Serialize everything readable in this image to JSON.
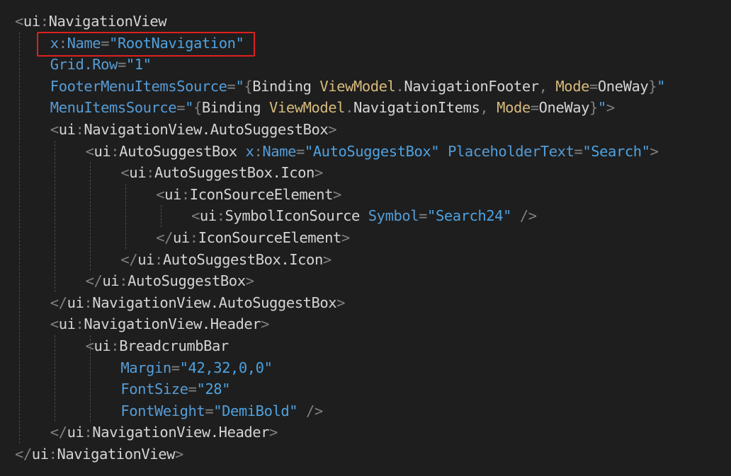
{
  "colors": {
    "background": "#1e1e1e",
    "bracket": "#808080",
    "element": "#d4d4d4",
    "prefix": "#9cdcfe",
    "attribute": "#569cd6",
    "value": "#4ea2e0",
    "markup": "#d7ba7d",
    "highlight": "#e02020"
  },
  "lines": [
    {
      "indent": 0,
      "tokens": [
        {
          "t": "<",
          "c": "bracket"
        },
        {
          "t": "ui",
          "c": "element"
        },
        {
          "t": ":",
          "c": "bracket"
        },
        {
          "t": "NavigationView",
          "c": "element"
        }
      ]
    },
    {
      "indent": 1,
      "highlight": true,
      "tokens": [
        {
          "t": "x",
          "c": "attribute"
        },
        {
          "t": ":",
          "c": "bracket"
        },
        {
          "t": "Name",
          "c": "attribute"
        },
        {
          "t": "=",
          "c": "bracket"
        },
        {
          "t": "\"RootNavigation\"",
          "c": "value"
        }
      ]
    },
    {
      "indent": 1,
      "tokens": [
        {
          "t": "Grid.Row",
          "c": "attribute"
        },
        {
          "t": "=",
          "c": "bracket"
        },
        {
          "t": "\"1\"",
          "c": "value"
        }
      ]
    },
    {
      "indent": 1,
      "tokens": [
        {
          "t": "FooterMenuItemsSource",
          "c": "attribute"
        },
        {
          "t": "=",
          "c": "bracket"
        },
        {
          "t": "\"",
          "c": "value"
        },
        {
          "t": "{",
          "c": "bracket"
        },
        {
          "t": "Binding ",
          "c": "element"
        },
        {
          "t": "ViewModel",
          "c": "markup"
        },
        {
          "t": ".",
          "c": "bracket"
        },
        {
          "t": "NavigationFooter",
          "c": "element"
        },
        {
          "t": ", ",
          "c": "bracket"
        },
        {
          "t": "Mode",
          "c": "markup"
        },
        {
          "t": "=",
          "c": "bracket"
        },
        {
          "t": "OneWay",
          "c": "element"
        },
        {
          "t": "}",
          "c": "bracket"
        },
        {
          "t": "\"",
          "c": "value"
        }
      ]
    },
    {
      "indent": 1,
      "tokens": [
        {
          "t": "MenuItemsSource",
          "c": "attribute"
        },
        {
          "t": "=",
          "c": "bracket"
        },
        {
          "t": "\"",
          "c": "value"
        },
        {
          "t": "{",
          "c": "bracket"
        },
        {
          "t": "Binding ",
          "c": "element"
        },
        {
          "t": "ViewModel",
          "c": "markup"
        },
        {
          "t": ".",
          "c": "bracket"
        },
        {
          "t": "NavigationItems",
          "c": "element"
        },
        {
          "t": ", ",
          "c": "bracket"
        },
        {
          "t": "Mode",
          "c": "markup"
        },
        {
          "t": "=",
          "c": "bracket"
        },
        {
          "t": "OneWay",
          "c": "element"
        },
        {
          "t": "}",
          "c": "bracket"
        },
        {
          "t": "\"",
          "c": "value"
        },
        {
          "t": ">",
          "c": "bracket"
        }
      ]
    },
    {
      "indent": 1,
      "tokens": [
        {
          "t": "<",
          "c": "bracket"
        },
        {
          "t": "ui",
          "c": "element"
        },
        {
          "t": ":",
          "c": "bracket"
        },
        {
          "t": "NavigationView.AutoSuggestBox",
          "c": "element"
        },
        {
          "t": ">",
          "c": "bracket"
        }
      ]
    },
    {
      "indent": 2,
      "tokens": [
        {
          "t": "<",
          "c": "bracket"
        },
        {
          "t": "ui",
          "c": "element"
        },
        {
          "t": ":",
          "c": "bracket"
        },
        {
          "t": "AutoSuggestBox ",
          "c": "element"
        },
        {
          "t": "x",
          "c": "attribute"
        },
        {
          "t": ":",
          "c": "bracket"
        },
        {
          "t": "Name",
          "c": "attribute"
        },
        {
          "t": "=",
          "c": "bracket"
        },
        {
          "t": "\"AutoSuggestBox\"",
          "c": "value"
        },
        {
          "t": " ",
          "c": "element"
        },
        {
          "t": "PlaceholderText",
          "c": "attribute"
        },
        {
          "t": "=",
          "c": "bracket"
        },
        {
          "t": "\"Search\"",
          "c": "value"
        },
        {
          "t": ">",
          "c": "bracket"
        }
      ]
    },
    {
      "indent": 3,
      "tokens": [
        {
          "t": "<",
          "c": "bracket"
        },
        {
          "t": "ui",
          "c": "element"
        },
        {
          "t": ":",
          "c": "bracket"
        },
        {
          "t": "AutoSuggestBox.Icon",
          "c": "element"
        },
        {
          "t": ">",
          "c": "bracket"
        }
      ]
    },
    {
      "indent": 4,
      "tokens": [
        {
          "t": "<",
          "c": "bracket"
        },
        {
          "t": "ui",
          "c": "element"
        },
        {
          "t": ":",
          "c": "bracket"
        },
        {
          "t": "IconSourceElement",
          "c": "element"
        },
        {
          "t": ">",
          "c": "bracket"
        }
      ]
    },
    {
      "indent": 5,
      "tokens": [
        {
          "t": "<",
          "c": "bracket"
        },
        {
          "t": "ui",
          "c": "element"
        },
        {
          "t": ":",
          "c": "bracket"
        },
        {
          "t": "SymbolIconSource ",
          "c": "element"
        },
        {
          "t": "Symbol",
          "c": "attribute"
        },
        {
          "t": "=",
          "c": "bracket"
        },
        {
          "t": "\"Search24\"",
          "c": "value"
        },
        {
          "t": " />",
          "c": "bracket"
        }
      ]
    },
    {
      "indent": 4,
      "tokens": [
        {
          "t": "</",
          "c": "bracket"
        },
        {
          "t": "ui",
          "c": "element"
        },
        {
          "t": ":",
          "c": "bracket"
        },
        {
          "t": "IconSourceElement",
          "c": "element"
        },
        {
          "t": ">",
          "c": "bracket"
        }
      ]
    },
    {
      "indent": 3,
      "tokens": [
        {
          "t": "</",
          "c": "bracket"
        },
        {
          "t": "ui",
          "c": "element"
        },
        {
          "t": ":",
          "c": "bracket"
        },
        {
          "t": "AutoSuggestBox.Icon",
          "c": "element"
        },
        {
          "t": ">",
          "c": "bracket"
        }
      ]
    },
    {
      "indent": 2,
      "tokens": [
        {
          "t": "</",
          "c": "bracket"
        },
        {
          "t": "ui",
          "c": "element"
        },
        {
          "t": ":",
          "c": "bracket"
        },
        {
          "t": "AutoSuggestBox",
          "c": "element"
        },
        {
          "t": ">",
          "c": "bracket"
        }
      ]
    },
    {
      "indent": 1,
      "tokens": [
        {
          "t": "</",
          "c": "bracket"
        },
        {
          "t": "ui",
          "c": "element"
        },
        {
          "t": ":",
          "c": "bracket"
        },
        {
          "t": "NavigationView.AutoSuggestBox",
          "c": "element"
        },
        {
          "t": ">",
          "c": "bracket"
        }
      ]
    },
    {
      "indent": 1,
      "tokens": [
        {
          "t": "<",
          "c": "bracket"
        },
        {
          "t": "ui",
          "c": "element"
        },
        {
          "t": ":",
          "c": "bracket"
        },
        {
          "t": "NavigationView.Header",
          "c": "element"
        },
        {
          "t": ">",
          "c": "bracket"
        }
      ]
    },
    {
      "indent": 2,
      "tokens": [
        {
          "t": "<",
          "c": "bracket"
        },
        {
          "t": "ui",
          "c": "element"
        },
        {
          "t": ":",
          "c": "bracket"
        },
        {
          "t": "BreadcrumbBar",
          "c": "element"
        }
      ]
    },
    {
      "indent": 3,
      "tokens": [
        {
          "t": "Margin",
          "c": "attribute"
        },
        {
          "t": "=",
          "c": "bracket"
        },
        {
          "t": "\"42,32,0,0\"",
          "c": "value"
        }
      ]
    },
    {
      "indent": 3,
      "tokens": [
        {
          "t": "FontSize",
          "c": "attribute"
        },
        {
          "t": "=",
          "c": "bracket"
        },
        {
          "t": "\"28\"",
          "c": "value"
        }
      ]
    },
    {
      "indent": 3,
      "tokens": [
        {
          "t": "FontWeight",
          "c": "attribute"
        },
        {
          "t": "=",
          "c": "bracket"
        },
        {
          "t": "\"DemiBold\"",
          "c": "value"
        },
        {
          "t": " />",
          "c": "bracket"
        }
      ]
    },
    {
      "indent": 1,
      "tokens": [
        {
          "t": "</",
          "c": "bracket"
        },
        {
          "t": "ui",
          "c": "element"
        },
        {
          "t": ":",
          "c": "bracket"
        },
        {
          "t": "NavigationView.Header",
          "c": "element"
        },
        {
          "t": ">",
          "c": "bracket"
        }
      ]
    },
    {
      "indent": 0,
      "tokens": [
        {
          "t": "</",
          "c": "bracket"
        },
        {
          "t": "ui",
          "c": "element"
        },
        {
          "t": ":",
          "c": "bracket"
        },
        {
          "t": "NavigationView",
          "c": "element"
        },
        {
          "t": ">",
          "c": "bracket"
        }
      ]
    }
  ]
}
